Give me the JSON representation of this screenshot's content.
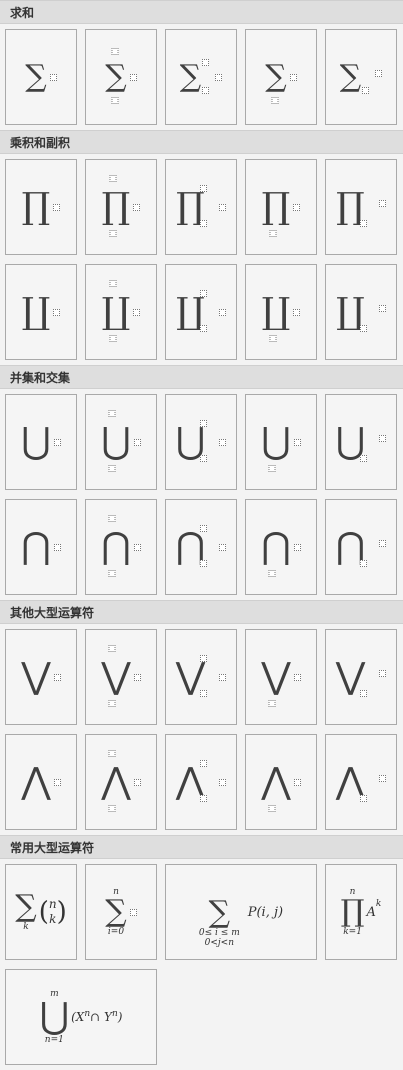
{
  "sections": [
    {
      "id": "sum",
      "title": "求和"
    },
    {
      "id": "product",
      "title": "乘积和副积"
    },
    {
      "id": "union",
      "title": "并集和交集"
    },
    {
      "id": "other",
      "title": "其他大型运算符"
    },
    {
      "id": "common",
      "title": "常用大型运算符"
    }
  ],
  "glyphs": {
    "sum": "∑",
    "prod": "∏",
    "coprod": "∐",
    "union": "⋃",
    "intersect": "⋂",
    "or": "⋁",
    "and": "⋀"
  },
  "common": {
    "t1": {
      "n": "n",
      "k_top": "k",
      "k_sub": "k"
    },
    "t2": {
      "top": "n",
      "bottom": "i=0"
    },
    "t3": {
      "expr": "P(i, j)",
      "line1": "0≤ i ≤ m",
      "line2": "0<j<n"
    },
    "t4": {
      "top": "n",
      "bottom": "k=1",
      "expr": "A",
      "expr_sub": "k"
    },
    "t5": {
      "top": "m",
      "bottom": "n=1",
      "expr": "(X",
      "n1": "n",
      "mid": " ∩ Y",
      "n2": "n",
      "close": ")"
    }
  }
}
